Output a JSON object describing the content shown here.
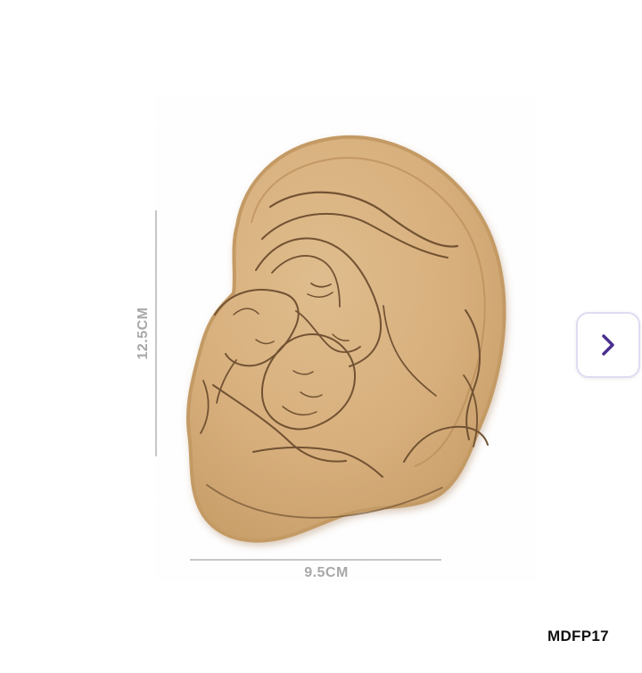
{
  "product": {
    "image_subject": "mother-and-child-mdf-cutout",
    "code": "MDFP17",
    "height_label": "12.5CM",
    "width_label": "9.5CM"
  },
  "controls": {
    "next_icon": "chevron-right-icon"
  },
  "colors": {
    "mdf": "#d9b27e",
    "mdf_edge": "#c49a63",
    "engraving": "#725233",
    "accent": "#4a2f8f",
    "dimension_line": "#c7c7c7",
    "dimension_text": "#a8a8a8"
  }
}
